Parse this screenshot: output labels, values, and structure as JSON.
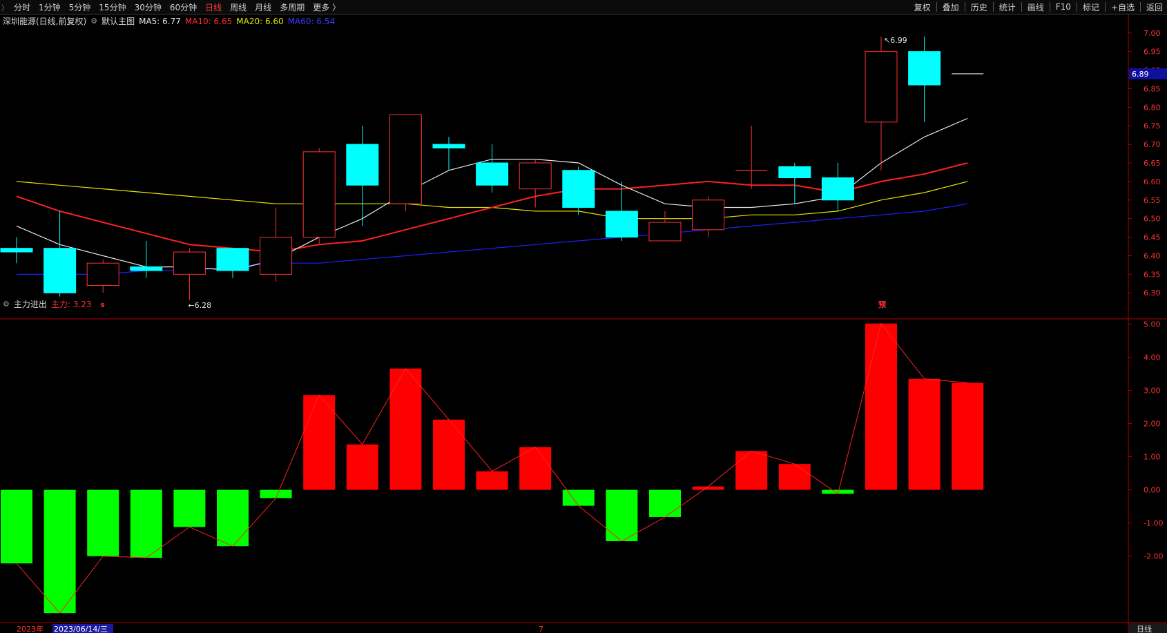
{
  "toolbar": {
    "left_items": [
      {
        "label": "分时",
        "active": false
      },
      {
        "label": "1分钟",
        "active": false
      },
      {
        "label": "5分钟",
        "active": false
      },
      {
        "label": "15分钟",
        "active": false
      },
      {
        "label": "30分钟",
        "active": false
      },
      {
        "label": "60分钟",
        "active": false
      },
      {
        "label": "日线",
        "active": true
      },
      {
        "label": "周线",
        "active": false
      },
      {
        "label": "月线",
        "active": false
      },
      {
        "label": "多周期",
        "active": false
      },
      {
        "label": "更多 〉",
        "active": false
      }
    ],
    "right_items": [
      "复权",
      "叠加",
      "历史",
      "统计",
      "画线",
      "F10",
      "标记",
      "+自选",
      "返回"
    ]
  },
  "main_info": {
    "title": "深圳能源(日线,前复权)",
    "template": "默认主图",
    "ma5": "MA5: 6.77",
    "ma10": "MA10: 6.65",
    "ma20": "MA20: 6.60",
    "ma60": "MA60: 6.54"
  },
  "sub_info": {
    "title": "主力进出",
    "value": "主力: 3.23"
  },
  "colors": {
    "up": "#ff3232",
    "down": "#00ffff",
    "ma5": "#e8e8e8",
    "ma10": "#ff2020",
    "ma20": "#e6e600",
    "ma60": "#2020ff",
    "bar_pos": "#ff0000",
    "bar_neg": "#00ff00"
  },
  "chart_data": {
    "type": "candlestick",
    "price_axis": {
      "min": 6.28,
      "max": 7.02,
      "ticks": [
        "7.00",
        "6.95",
        "6.90",
        "6.85",
        "6.80",
        "6.75",
        "6.70",
        "6.65",
        "6.60",
        "6.55",
        "6.50",
        "6.45",
        "6.40",
        "6.35",
        "6.30"
      ]
    },
    "current_price_label": "6.89",
    "high_annotation": "6.99",
    "low_annotation": "6.28",
    "event_markers": [
      {
        "index": 2,
        "text": "s"
      },
      {
        "index": 20,
        "text": "预"
      }
    ],
    "candles": [
      {
        "o": 6.42,
        "h": 6.45,
        "l": 6.38,
        "c": 6.41
      },
      {
        "o": 6.42,
        "h": 6.52,
        "l": 6.29,
        "c": 6.3
      },
      {
        "o": 6.32,
        "h": 6.39,
        "l": 6.3,
        "c": 6.38
      },
      {
        "o": 6.37,
        "h": 6.44,
        "l": 6.34,
        "c": 6.36
      },
      {
        "o": 6.35,
        "h": 6.42,
        "l": 6.28,
        "c": 6.41
      },
      {
        "o": 6.42,
        "h": 6.42,
        "l": 6.34,
        "c": 6.36
      },
      {
        "o": 6.35,
        "h": 6.53,
        "l": 6.33,
        "c": 6.45
      },
      {
        "o": 6.45,
        "h": 6.69,
        "l": 6.43,
        "c": 6.68
      },
      {
        "o": 6.7,
        "h": 6.75,
        "l": 6.48,
        "c": 6.59
      },
      {
        "o": 6.54,
        "h": 6.78,
        "l": 6.52,
        "c": 6.78
      },
      {
        "o": 6.7,
        "h": 6.72,
        "l": 6.63,
        "c": 6.69
      },
      {
        "o": 6.65,
        "h": 6.7,
        "l": 6.57,
        "c": 6.59
      },
      {
        "o": 6.58,
        "h": 6.66,
        "l": 6.53,
        "c": 6.65
      },
      {
        "o": 6.63,
        "h": 6.64,
        "l": 6.51,
        "c": 6.53
      },
      {
        "o": 6.52,
        "h": 6.6,
        "l": 6.44,
        "c": 6.45
      },
      {
        "o": 6.44,
        "h": 6.52,
        "l": 6.44,
        "c": 6.49
      },
      {
        "o": 6.47,
        "h": 6.56,
        "l": 6.45,
        "c": 6.55
      },
      {
        "o": 6.63,
        "h": 6.75,
        "l": 6.58,
        "c": 6.63
      },
      {
        "o": 6.64,
        "h": 6.65,
        "l": 6.54,
        "c": 6.61
      },
      {
        "o": 6.61,
        "h": 6.65,
        "l": 6.52,
        "c": 6.55
      },
      {
        "o": 6.76,
        "h": 6.99,
        "l": 6.63,
        "c": 6.95
      },
      {
        "o": 6.95,
        "h": 6.99,
        "l": 6.76,
        "c": 6.86
      },
      {
        "o": 6.89,
        "h": 6.89,
        "l": 6.89,
        "c": 6.89
      }
    ],
    "ma5": [
      6.48,
      6.43,
      6.4,
      6.37,
      6.37,
      6.36,
      6.39,
      6.45,
      6.5,
      6.57,
      6.63,
      6.66,
      6.66,
      6.65,
      6.59,
      6.54,
      6.53,
      6.53,
      6.54,
      6.56,
      6.65,
      6.72,
      6.77
    ],
    "ma10": [
      6.56,
      6.52,
      6.49,
      6.46,
      6.43,
      6.42,
      6.41,
      6.43,
      6.44,
      6.47,
      6.5,
      6.53,
      6.56,
      6.58,
      6.58,
      6.59,
      6.6,
      6.59,
      6.59,
      6.57,
      6.6,
      6.62,
      6.65
    ],
    "ma20": [
      6.6,
      6.59,
      6.58,
      6.57,
      6.56,
      6.55,
      6.54,
      6.54,
      6.54,
      6.54,
      6.53,
      6.53,
      6.52,
      6.52,
      6.5,
      6.5,
      6.5,
      6.51,
      6.51,
      6.52,
      6.55,
      6.57,
      6.6
    ],
    "ma60": [
      6.35,
      6.35,
      6.35,
      6.36,
      6.36,
      6.37,
      6.38,
      6.38,
      6.39,
      6.4,
      6.41,
      6.42,
      6.43,
      6.44,
      6.45,
      6.46,
      6.47,
      6.48,
      6.49,
      6.5,
      6.51,
      6.52,
      6.54
    ],
    "ma_start_index": {
      "ma5": 0,
      "ma10": 0,
      "ma20": 0,
      "ma60": 0
    },
    "indicator": {
      "name": "主力进出",
      "axis_ticks": [
        "5.00",
        "4.00",
        "3.00",
        "2.00",
        "1.00",
        "0.00",
        "-1.00",
        "-2.00"
      ],
      "ylim": [
        -3.8,
        5.2
      ],
      "values": [
        -2.22,
        -3.72,
        -2.0,
        -2.05,
        -1.12,
        -1.7,
        -0.25,
        2.86,
        1.37,
        3.66,
        2.12,
        0.56,
        1.29,
        -0.48,
        -1.55,
        -0.82,
        0.1,
        1.17,
        0.78,
        -0.12,
        5.02,
        3.35,
        3.23
      ]
    },
    "date_axis": {
      "year_label": "2023年",
      "cursor_date": "2023/06/14/三",
      "month_label": "7"
    }
  },
  "status": {
    "period_label": "日线"
  }
}
